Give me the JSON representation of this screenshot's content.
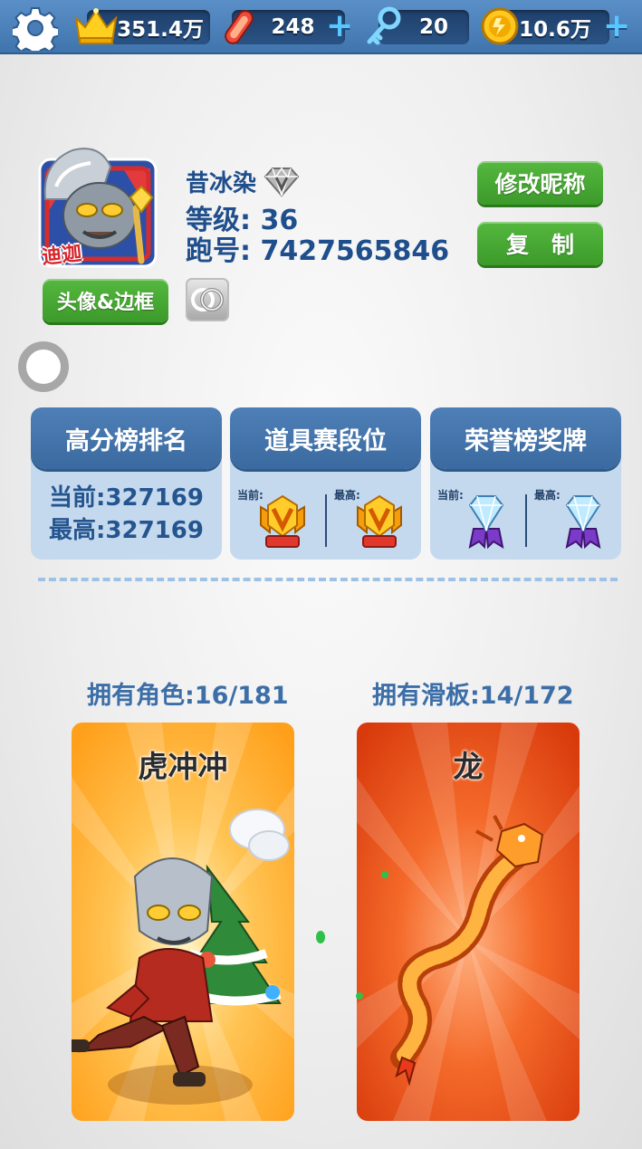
{
  "topbar": {
    "settings_icon": "gear-icon",
    "crown_value": "351.4万",
    "board_value": "248",
    "key_value": "20",
    "coin_value": "10.6万",
    "plus_symbol": "+"
  },
  "profile": {
    "avatar_caption": "迪迦",
    "nickname": "昔冰染",
    "level_text": "等级: 36",
    "id_text": "跑号: 7427565846",
    "rename_button": "修改昵称",
    "copy_button": "复　制",
    "avatar_frame_button": "头像&边框"
  },
  "cards": {
    "leaderboard": {
      "title": "高分榜排名",
      "current": "当前:327169",
      "best": "最高:327169"
    },
    "item_tier": {
      "title": "道具赛段位",
      "current_label": "当前:",
      "best_label": "最高:"
    },
    "honor_medal": {
      "title": "荣誉榜奖牌",
      "current_label": "当前:",
      "best_label": "最高:"
    }
  },
  "collection": {
    "characters_label": "拥有角色:16/181",
    "boards_label": "拥有滑板:14/172",
    "character_name": "虎冲冲",
    "board_name": "龙"
  },
  "colors": {
    "accent_blue": "#3f74ad",
    "button_green": "#46a832",
    "character_bg": "#ffb13a",
    "board_bg": "#e84a16"
  }
}
